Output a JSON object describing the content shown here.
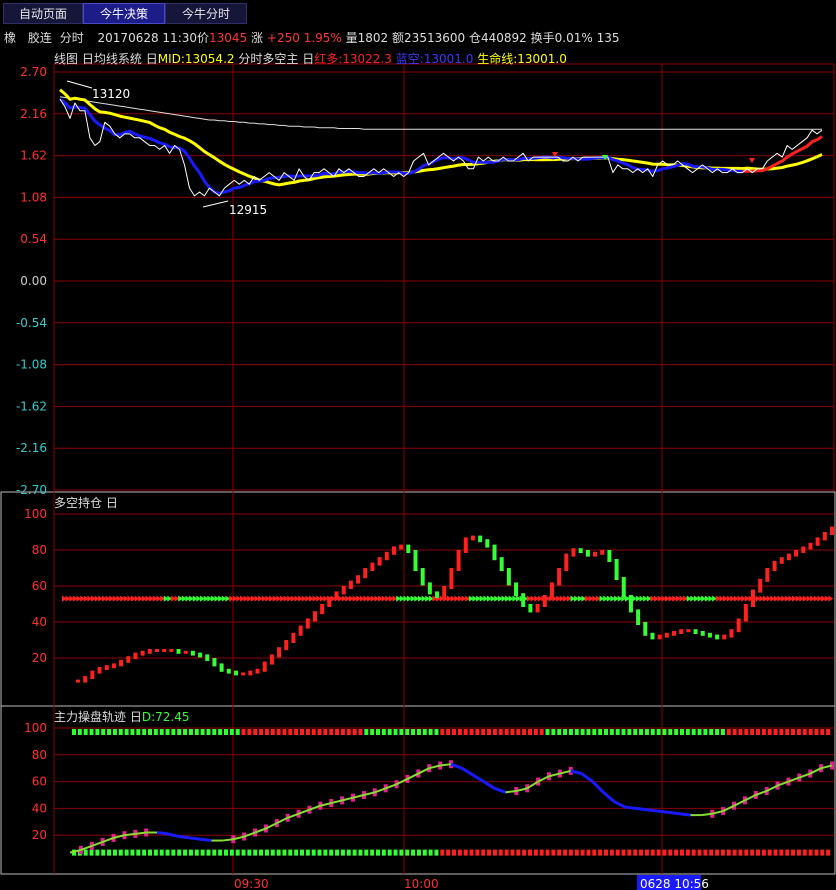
{
  "tabs": [
    {
      "label": "自动页面",
      "active": false
    },
    {
      "label": "今牛决策",
      "active": true
    },
    {
      "label": "今牛分时",
      "active": false
    }
  ],
  "info": {
    "symbol": "橡",
    "exchange": "胶连",
    "mode": "分时",
    "date_time": "20170628 11:30",
    "price_label": "价",
    "price": "13045",
    "change_label": "涨",
    "change": "+250",
    "change_pct": "1.95%",
    "volume_label": "量",
    "volume": "1802",
    "amount_label": "额",
    "amount": "23513600",
    "oi_label": "仓",
    "oi": "440892",
    "turnover_label": "换手",
    "turnover": "0.01%",
    "extra": "135"
  },
  "colors": {
    "grid": "#8b0000",
    "white": "#ffffff",
    "yellow": "#ffff00",
    "blue": "#1a1aff",
    "red": "#ff2020",
    "green": "#33ff33",
    "magenta": "#e0208c",
    "tick_red": "#ff3030",
    "tick_cyan": "#33cccc"
  },
  "main_panel": {
    "legend": {
      "line_label": "线图",
      "toggle1": "日",
      "system_label": "均线系统",
      "toggle2": "日",
      "mid_label": "MID:13054.2",
      "timeshare_label": "分时多空主",
      "toggle3": "日",
      "red_label": "红多:13022.3",
      "blue_label": "蓝空:13001.0",
      "life_label": "生命线:13001.0"
    },
    "y_ticks": [
      "2.70",
      "2.16",
      "1.62",
      "1.08",
      "0.54",
      "0.00",
      "-0.54",
      "-1.08",
      "-1.62",
      "-2.16",
      "-2.70"
    ],
    "annotations": {
      "high": "13120",
      "low": "12915"
    }
  },
  "sub_panel_1": {
    "legend": {
      "title": "多空持仓",
      "toggle": "日"
    },
    "y_ticks": [
      "100",
      "80",
      "60",
      "40",
      "20"
    ]
  },
  "sub_panel_2": {
    "legend": {
      "title": "主力操盘轨迹",
      "toggle": "日",
      "value": "D:72.45"
    },
    "y_ticks": [
      "100",
      "80",
      "60",
      "40",
      "20"
    ]
  },
  "time_axis": {
    "labels": [
      "09:30",
      "10:00"
    ],
    "cursor": "0628 10:56"
  },
  "chart_data": [
    {
      "type": "line",
      "title": "分时",
      "ylim": [
        -2.7,
        2.7
      ],
      "x": [
        0,
        5,
        10,
        15,
        20,
        25,
        30,
        35,
        40,
        45,
        50,
        55,
        60,
        65,
        70,
        75,
        80,
        85,
        90,
        95,
        100,
        105,
        110,
        115,
        120,
        125,
        130,
        135,
        140,
        145,
        150,
        155,
        160,
        165,
        170,
        175,
        180,
        185,
        190,
        195,
        200,
        205,
        210,
        215,
        220,
        225,
        230,
        235,
        240,
        245,
        250,
        255,
        260,
        265,
        270,
        275,
        280,
        285,
        290,
        295,
        300,
        305,
        310,
        315,
        320,
        325,
        330,
        335,
        340,
        345,
        350,
        355,
        360,
        365,
        370,
        375,
        380,
        385,
        390,
        395,
        400,
        405,
        410,
        415,
        420,
        425,
        430,
        435,
        440,
        445,
        450,
        455,
        460,
        465,
        470,
        475,
        480,
        485,
        490,
        495,
        500,
        505,
        510,
        515,
        520,
        525,
        530,
        535,
        540,
        545,
        550,
        555,
        560,
        565,
        570,
        575,
        580,
        585,
        590,
        595,
        600,
        605,
        610,
        615,
        620,
        625,
        630,
        635,
        640,
        645,
        650,
        655,
        660,
        665,
        670,
        675,
        680,
        685,
        690,
        695,
        700,
        705,
        710,
        715,
        720,
        725,
        730,
        735,
        740,
        745,
        750,
        755,
        760,
        765,
        770,
        775
      ],
      "series": [
        {
          "name": "price",
          "values": [
            2.35,
            2.25,
            2.1,
            2.3,
            2.2,
            2.2,
            1.85,
            1.75,
            1.8,
            2.05,
            2.0,
            1.9,
            1.85,
            1.9,
            1.9,
            1.85,
            1.85,
            1.8,
            1.75,
            1.75,
            1.7,
            1.75,
            1.65,
            1.75,
            1.7,
            1.5,
            1.2,
            1.1,
            1.15,
            1.1,
            1.2,
            1.15,
            1.1,
            1.2,
            1.25,
            1.3,
            1.25,
            1.3,
            1.25,
            1.35,
            1.3,
            1.35,
            1.4,
            1.35,
            1.3,
            1.4,
            1.35,
            1.3,
            1.45,
            1.35,
            1.3,
            1.4,
            1.4,
            1.45,
            1.4,
            1.35,
            1.45,
            1.4,
            1.45,
            1.4,
            1.35,
            1.35,
            1.4,
            1.45,
            1.4,
            1.45,
            1.4,
            1.35,
            1.4,
            1.35,
            1.4,
            1.55,
            1.6,
            1.65,
            1.5,
            1.55,
            1.6,
            1.65,
            1.6,
            1.55,
            1.6,
            1.55,
            1.45,
            1.45,
            1.6,
            1.55,
            1.6,
            1.55,
            1.55,
            1.6,
            1.55,
            1.55,
            1.6,
            1.65,
            1.55,
            1.6,
            1.6,
            1.6,
            1.6,
            1.6,
            1.6,
            1.55,
            1.55,
            1.6,
            1.55,
            1.6,
            1.6,
            1.6,
            1.6,
            1.6,
            1.6,
            1.4,
            1.5,
            1.45,
            1.45,
            1.4,
            1.45,
            1.4,
            1.45,
            1.35,
            1.5,
            1.55,
            1.5,
            1.5,
            1.55,
            1.5,
            1.45,
            1.4,
            1.45,
            1.5,
            1.45,
            1.4,
            1.45,
            1.4,
            1.4,
            1.45,
            1.4,
            1.4,
            1.45,
            1.4,
            1.45,
            1.45,
            1.55,
            1.6,
            1.65,
            1.6,
            1.75,
            1.7,
            1.75,
            1.8,
            1.85,
            1.95,
            1.9,
            1.95
          ]
        },
        {
          "name": "avg",
          "values": [
            2.38,
            2.37,
            2.36,
            2.35,
            2.34,
            2.33,
            2.32,
            2.31,
            2.3,
            2.29,
            2.28,
            2.27,
            2.26,
            2.25,
            2.24,
            2.23,
            2.22,
            2.21,
            2.2,
            2.19,
            2.18,
            2.17,
            2.16,
            2.15,
            2.14,
            2.13,
            2.12,
            2.11,
            2.1,
            2.09,
            2.08,
            2.08,
            2.07,
            2.07,
            2.06,
            2.06,
            2.05,
            2.05,
            2.04,
            2.04,
            2.03,
            2.03,
            2.02,
            2.02,
            2.01,
            2.01,
            2.0,
            2.0,
            2.0,
            1.99,
            1.99,
            1.99,
            1.98,
            1.98,
            1.98,
            1.98,
            1.97,
            1.97,
            1.97,
            1.97,
            1.97,
            1.96,
            1.96,
            1.96,
            1.96,
            1.96,
            1.96,
            1.96,
            1.96,
            1.96,
            1.96,
            1.96,
            1.96,
            1.96,
            1.96,
            1.96,
            1.96,
            1.96,
            1.96,
            1.96,
            1.96,
            1.96,
            1.96,
            1.96,
            1.96,
            1.96,
            1.96,
            1.96,
            1.96,
            1.96,
            1.96,
            1.96,
            1.96,
            1.96,
            1.96,
            1.96,
            1.96,
            1.96,
            1.96,
            1.96,
            1.96,
            1.96,
            1.96,
            1.96,
            1.96,
            1.96,
            1.96,
            1.96,
            1.96,
            1.96,
            1.96,
            1.96,
            1.96,
            1.96,
            1.96,
            1.96,
            1.96,
            1.96,
            1.96,
            1.96,
            1.96,
            1.96,
            1.96,
            1.96,
            1.96,
            1.96,
            1.96,
            1.96,
            1.96,
            1.96,
            1.96,
            1.96,
            1.96,
            1.96,
            1.96,
            1.96,
            1.96,
            1.96,
            1.96,
            1.96,
            1.96,
            1.96,
            1.96,
            1.96,
            1.96,
            1.96,
            1.96,
            1.96,
            1.96,
            1.96,
            1.96,
            1.96,
            1.96,
            1.96
          ]
        }
      ]
    },
    {
      "type": "bar",
      "title": "多空持仓",
      "ylim": [
        0,
        100
      ],
      "values": [
        8,
        10,
        13,
        15,
        16,
        17,
        19,
        21,
        23,
        24,
        25,
        25,
        25,
        25,
        24,
        24,
        23,
        22,
        20,
        17,
        14,
        13,
        12,
        12,
        13,
        14,
        18,
        22,
        26,
        30,
        34,
        38,
        42,
        46,
        50,
        54,
        57,
        60,
        63,
        66,
        70,
        73,
        76,
        79,
        82,
        83,
        80,
        70,
        62,
        57,
        55,
        60,
        70,
        80,
        87,
        88,
        86,
        83,
        76,
        70,
        62,
        56,
        50,
        47,
        50,
        55,
        62,
        70,
        78,
        81,
        80,
        78,
        79,
        80,
        75,
        65,
        55,
        47,
        40,
        34,
        32,
        33,
        34,
        35,
        36,
        36,
        35,
        34,
        33,
        32,
        33,
        36,
        42,
        50,
        58,
        64,
        70,
        74,
        76,
        78,
        80,
        82,
        84,
        87,
        90,
        93
      ]
    },
    {
      "type": "line",
      "title": "主力操盘轨迹",
      "ylim": [
        0,
        100
      ],
      "values": [
        7,
        9,
        12,
        15,
        18,
        20,
        21,
        22,
        22,
        21,
        19,
        18,
        17,
        16,
        16,
        17,
        19,
        22,
        25,
        29,
        33,
        36,
        39,
        42,
        44,
        46,
        48,
        50,
        52,
        55,
        58,
        62,
        66,
        70,
        72,
        73,
        70,
        65,
        60,
        55,
        52,
        53,
        55,
        60,
        64,
        66,
        68,
        66,
        60,
        52,
        45,
        41,
        40,
        39,
        38,
        37,
        36,
        35,
        35,
        36,
        38,
        42,
        46,
        50,
        53,
        57,
        60,
        63,
        66,
        70,
        72
      ]
    }
  ]
}
